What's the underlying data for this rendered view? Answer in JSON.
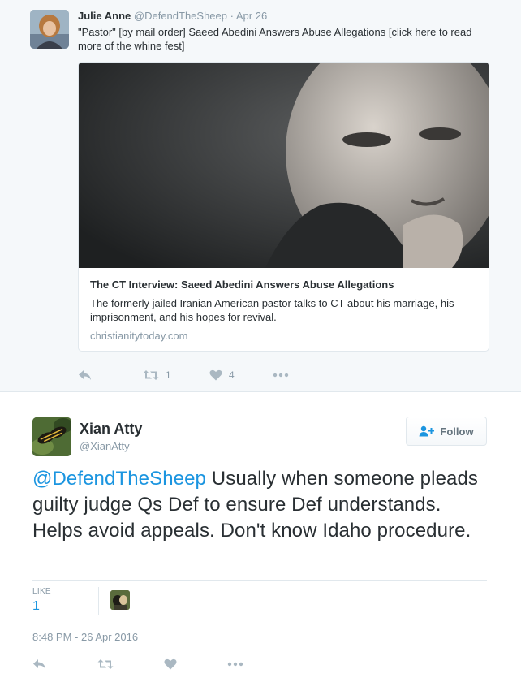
{
  "parent_tweet": {
    "author_name": "Julie Anne",
    "author_handle": "@DefendTheSheep",
    "separator": "·",
    "date": "Apr 26",
    "text": "\"Pastor\" [by mail order] Saeed Abedini Answers Abuse Allegations [click here to read more of the whine fest]",
    "card": {
      "title": "The CT Interview: Saeed Abedini Answers Abuse Allegations",
      "description": "The formerly jailed Iranian American pastor talks to CT about his marriage, his imprisonment, and his hopes for revival.",
      "domain": "christianitytoday.com"
    },
    "actions": {
      "reply_icon": "reply-icon",
      "retweet_icon": "retweet-icon",
      "retweet_count": "1",
      "like_icon": "heart-icon",
      "like_count": "4",
      "more_icon": "more-icon"
    }
  },
  "main_tweet": {
    "author_name": "Xian Atty",
    "author_handle": "@XianAtty",
    "follow_label": "Follow",
    "text_mention": "@DefendTheSheep",
    "text_body": " Usually when someone pleads guilty judge Qs Def to ensure Def understands. Helps avoid appeals. Don't know Idaho procedure.",
    "likes_label": "LIKE",
    "likes_count": "1",
    "timestamp": "8:48 PM - 26 Apr 2016",
    "actions": {
      "reply_icon": "reply-icon",
      "retweet_icon": "retweet-icon",
      "like_icon": "heart-icon",
      "more_icon": "more-icon"
    }
  },
  "colors": {
    "link": "#1b95e0",
    "muted": "#8899a6",
    "icon": "#aab8c2",
    "text": "#292f33",
    "parent_bg": "#f5f8fa",
    "border": "#e1e8ed"
  }
}
